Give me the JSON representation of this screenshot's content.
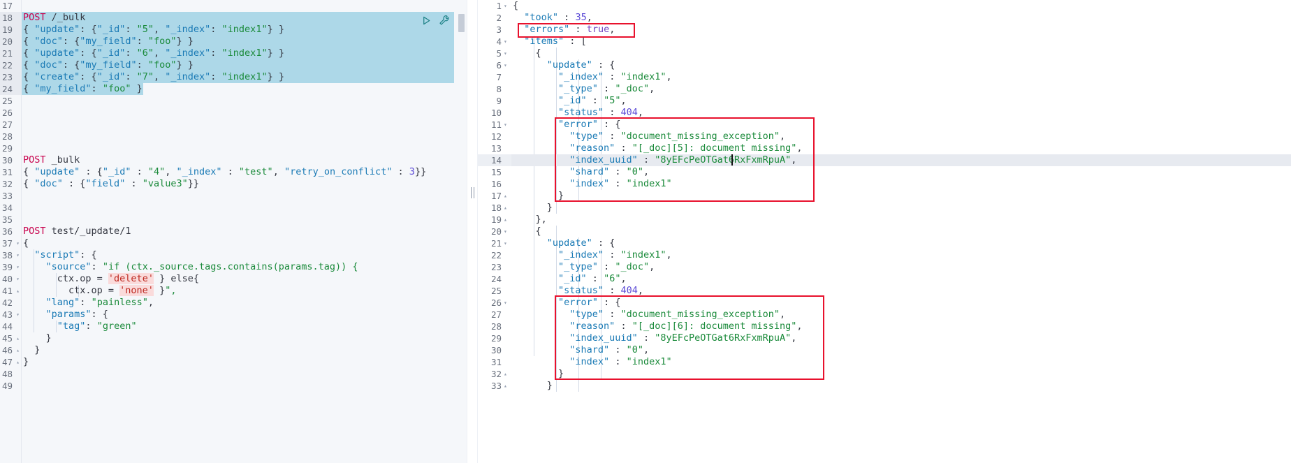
{
  "app": {
    "name": "kibana-dev-tools-console",
    "accent_red": "#e8112d",
    "selection_color": "#add8e8",
    "highlight_row_color": "#e7eaf0"
  },
  "request_editor": {
    "name": "request-editor",
    "first_line_number": 17,
    "last_line_number": 49,
    "selected_line_range": [
      18,
      24
    ],
    "actions": [
      {
        "name": "send-request-icon",
        "label": "Click to send request"
      },
      {
        "name": "wrench-icon",
        "label": "Open documentation / tools"
      }
    ],
    "lines": [
      {
        "n": 17,
        "text": "",
        "fold": ""
      },
      {
        "n": 18,
        "text": "POST /_bulk",
        "fold": ""
      },
      {
        "n": 19,
        "text": "{ \"update\": {\"_id\": \"5\", \"_index\": \"index1\"} }",
        "fold": ""
      },
      {
        "n": 20,
        "text": "{ \"doc\": {\"my_field\": \"foo\"} }",
        "fold": ""
      },
      {
        "n": 21,
        "text": "{ \"update\": {\"_id\": \"6\", \"_index\": \"index1\"} }",
        "fold": ""
      },
      {
        "n": 22,
        "text": "{ \"doc\": {\"my_field\": \"foo\"} }",
        "fold": ""
      },
      {
        "n": 23,
        "text": "{ \"create\": {\"_id\": \"7\", \"_index\": \"index1\"} }",
        "fold": ""
      },
      {
        "n": 24,
        "text": "{ \"my_field\": \"foo\" }",
        "fold": ""
      },
      {
        "n": 25,
        "text": "",
        "fold": ""
      },
      {
        "n": 26,
        "text": "",
        "fold": ""
      },
      {
        "n": 27,
        "text": "",
        "fold": ""
      },
      {
        "n": 28,
        "text": "",
        "fold": ""
      },
      {
        "n": 29,
        "text": "",
        "fold": ""
      },
      {
        "n": 30,
        "text": "POST _bulk",
        "fold": ""
      },
      {
        "n": 31,
        "text": "{ \"update\" : {\"_id\" : \"4\", \"_index\" : \"test\", \"retry_on_conflict\" : 3}}",
        "fold": ""
      },
      {
        "n": 32,
        "text": "{ \"doc\" : {\"field\" : \"value3\"}}",
        "fold": ""
      },
      {
        "n": 33,
        "text": "",
        "fold": ""
      },
      {
        "n": 34,
        "text": "",
        "fold": ""
      },
      {
        "n": 35,
        "text": "",
        "fold": ""
      },
      {
        "n": 36,
        "text": "POST test/_update/1",
        "fold": ""
      },
      {
        "n": 37,
        "text": "{",
        "fold": "down"
      },
      {
        "n": 38,
        "text": "  \"script\": {",
        "fold": "down"
      },
      {
        "n": 39,
        "text": "    \"source\": \"if (ctx._source.tags.contains(params.tag)) {",
        "fold": "down"
      },
      {
        "n": 40,
        "text": "      ctx.op = 'delete' } else{",
        "fold": "down"
      },
      {
        "n": 41,
        "text": "        ctx.op = 'none' }\",",
        "fold": "up"
      },
      {
        "n": 42,
        "text": "    \"lang\": \"painless\",",
        "fold": ""
      },
      {
        "n": 43,
        "text": "    \"params\": {",
        "fold": "down"
      },
      {
        "n": 44,
        "text": "      \"tag\": \"green\"",
        "fold": ""
      },
      {
        "n": 45,
        "text": "    }",
        "fold": "up"
      },
      {
        "n": 46,
        "text": "  }",
        "fold": "up"
      },
      {
        "n": 47,
        "text": "}",
        "fold": "up"
      },
      {
        "n": 48,
        "text": "",
        "fold": ""
      },
      {
        "n": 49,
        "text": "",
        "fold": ""
      }
    ]
  },
  "response_viewer": {
    "name": "response-viewer",
    "first_line_number": 1,
    "last_line_number": 33,
    "highlighted_line": 14,
    "cursor_line": 14,
    "lines": [
      {
        "n": 1,
        "text": "{",
        "fold": "down"
      },
      {
        "n": 2,
        "text": "  \"took\" : 35,",
        "fold": ""
      },
      {
        "n": 3,
        "text": "  \"errors\" : true,",
        "fold": ""
      },
      {
        "n": 4,
        "text": "  \"items\" : [",
        "fold": "down"
      },
      {
        "n": 5,
        "text": "    {",
        "fold": "down"
      },
      {
        "n": 6,
        "text": "      \"update\" : {",
        "fold": "down"
      },
      {
        "n": 7,
        "text": "        \"_index\" : \"index1\",",
        "fold": ""
      },
      {
        "n": 8,
        "text": "        \"_type\" : \"_doc\",",
        "fold": ""
      },
      {
        "n": 9,
        "text": "        \"_id\" : \"5\",",
        "fold": ""
      },
      {
        "n": 10,
        "text": "        \"status\" : 404,",
        "fold": ""
      },
      {
        "n": 11,
        "text": "        \"error\" : {",
        "fold": "down"
      },
      {
        "n": 12,
        "text": "          \"type\" : \"document_missing_exception\",",
        "fold": ""
      },
      {
        "n": 13,
        "text": "          \"reason\" : \"[_doc][5]: document missing\",",
        "fold": ""
      },
      {
        "n": 14,
        "text": "          \"index_uuid\" : \"8yEFcPeOTGat6RxFxmRpuA\",",
        "fold": ""
      },
      {
        "n": 15,
        "text": "          \"shard\" : \"0\",",
        "fold": ""
      },
      {
        "n": 16,
        "text": "          \"index\" : \"index1\"",
        "fold": ""
      },
      {
        "n": 17,
        "text": "        }",
        "fold": "up"
      },
      {
        "n": 18,
        "text": "      }",
        "fold": "up"
      },
      {
        "n": 19,
        "text": "    },",
        "fold": "up"
      },
      {
        "n": 20,
        "text": "    {",
        "fold": "down"
      },
      {
        "n": 21,
        "text": "      \"update\" : {",
        "fold": "down"
      },
      {
        "n": 22,
        "text": "        \"_index\" : \"index1\",",
        "fold": ""
      },
      {
        "n": 23,
        "text": "        \"_type\" : \"_doc\",",
        "fold": ""
      },
      {
        "n": 24,
        "text": "        \"_id\" : \"6\",",
        "fold": ""
      },
      {
        "n": 25,
        "text": "        \"status\" : 404,",
        "fold": ""
      },
      {
        "n": 26,
        "text": "        \"error\" : {",
        "fold": "down"
      },
      {
        "n": 27,
        "text": "          \"type\" : \"document_missing_exception\",",
        "fold": ""
      },
      {
        "n": 28,
        "text": "          \"reason\" : \"[_doc][6]: document missing\",",
        "fold": ""
      },
      {
        "n": 29,
        "text": "          \"index_uuid\" : \"8yEFcPeOTGat6RxFxmRpuA\",",
        "fold": ""
      },
      {
        "n": 30,
        "text": "          \"shard\" : \"0\",",
        "fold": ""
      },
      {
        "n": 31,
        "text": "          \"index\" : \"index1\"",
        "fold": ""
      },
      {
        "n": 32,
        "text": "        }",
        "fold": "up"
      },
      {
        "n": 33,
        "text": "      }",
        "fold": "up"
      }
    ],
    "annotations": [
      {
        "name": "errors-true-annotation",
        "label": "\"errors\" : true,"
      },
      {
        "name": "first-error-annotation",
        "label": "error block for _id 5"
      },
      {
        "name": "second-error-annotation",
        "label": "error block for _id 6"
      }
    ]
  }
}
